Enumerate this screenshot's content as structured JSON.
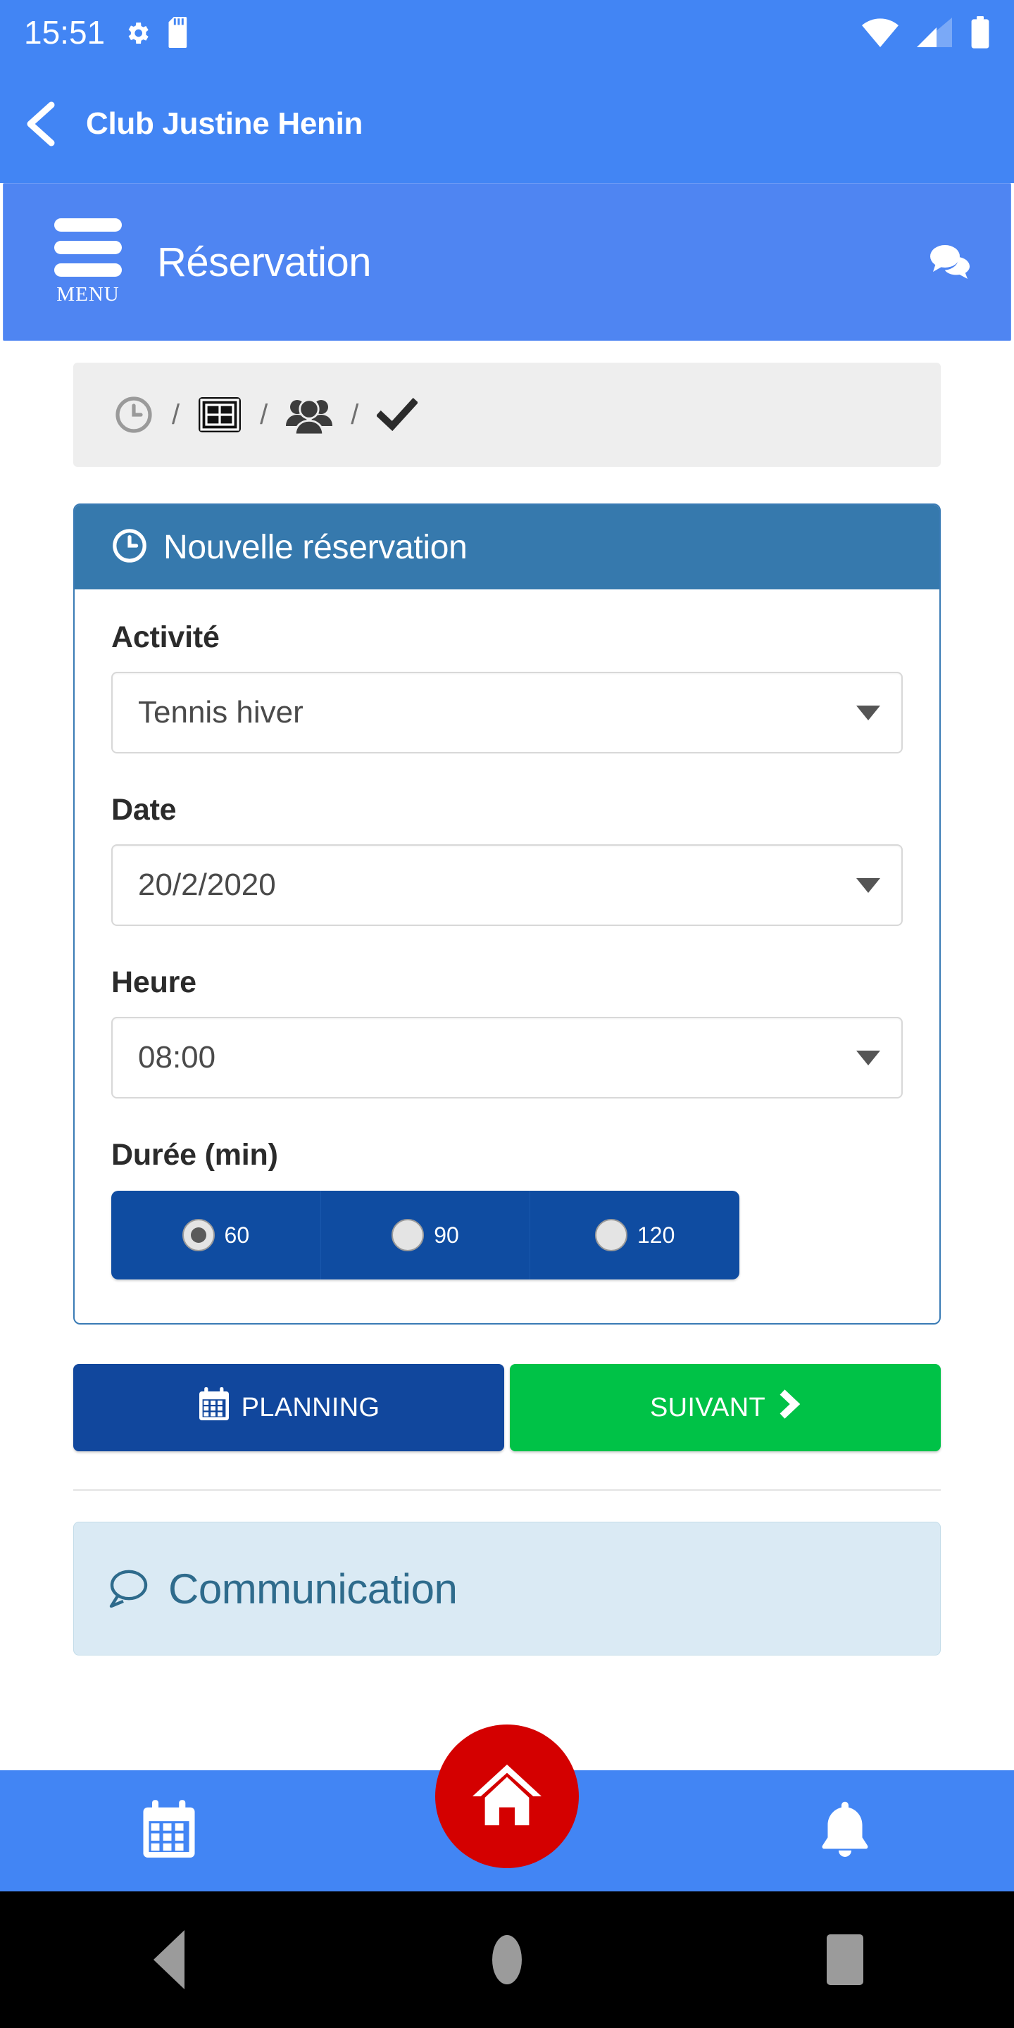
{
  "status_bar": {
    "time": "15:51",
    "icons_left": [
      "gear-icon",
      "sd-card-icon"
    ],
    "icons_right": [
      "wifi-icon",
      "cell-signal-icon",
      "battery-icon"
    ]
  },
  "app_bar": {
    "back_label": "back-chevron",
    "title": "Club Justine Henin"
  },
  "reservation_header": {
    "menu_label": "MENU",
    "title": "Réservation",
    "chat_icon": "chat-bubbles-icon"
  },
  "breadcrumb": {
    "separator": "/",
    "steps": [
      {
        "icon": "clock-icon",
        "state": "current"
      },
      {
        "icon": "court-icon",
        "state": "todo"
      },
      {
        "icon": "people-group-icon",
        "state": "todo"
      },
      {
        "icon": "checkmark-icon",
        "state": "todo"
      }
    ]
  },
  "card": {
    "header_icon": "clock-icon",
    "header_title": "Nouvelle réservation",
    "fields": {
      "activity": {
        "label": "Activité",
        "value": "Tennis hiver"
      },
      "date": {
        "label": "Date",
        "value": "20/2/2020"
      },
      "time": {
        "label": "Heure",
        "value": "08:00"
      },
      "duration": {
        "label": "Durée (min)",
        "options": [
          {
            "value": "60",
            "selected": true
          },
          {
            "value": "90",
            "selected": false
          },
          {
            "value": "120",
            "selected": false
          }
        ]
      }
    }
  },
  "actions": {
    "planning": {
      "label": "PLANNING",
      "icon": "calendar-icon",
      "color": "#11479d"
    },
    "next": {
      "label": "SUIVANT",
      "icon": "chevron-right-icon",
      "color": "#00c247"
    }
  },
  "communication": {
    "icon": "speech-bubble-icon",
    "title": "Communication"
  },
  "bottom_nav": {
    "items": [
      {
        "icon": "calendar-icon",
        "name": "planning"
      },
      {
        "icon": "home-icon",
        "name": "home"
      },
      {
        "icon": "bell-icon",
        "name": "notifications"
      }
    ]
  },
  "android_nav": {
    "back": "back-triangle",
    "home": "home-circle",
    "recents": "recents-square"
  },
  "colors": {
    "primary_blue": "#4285F4",
    "header_blue": "#4F85F2",
    "card_header_blue": "#3679ad",
    "dark_blue": "#0f4ca1",
    "green": "#00c247",
    "red_fab": "#d40000"
  }
}
